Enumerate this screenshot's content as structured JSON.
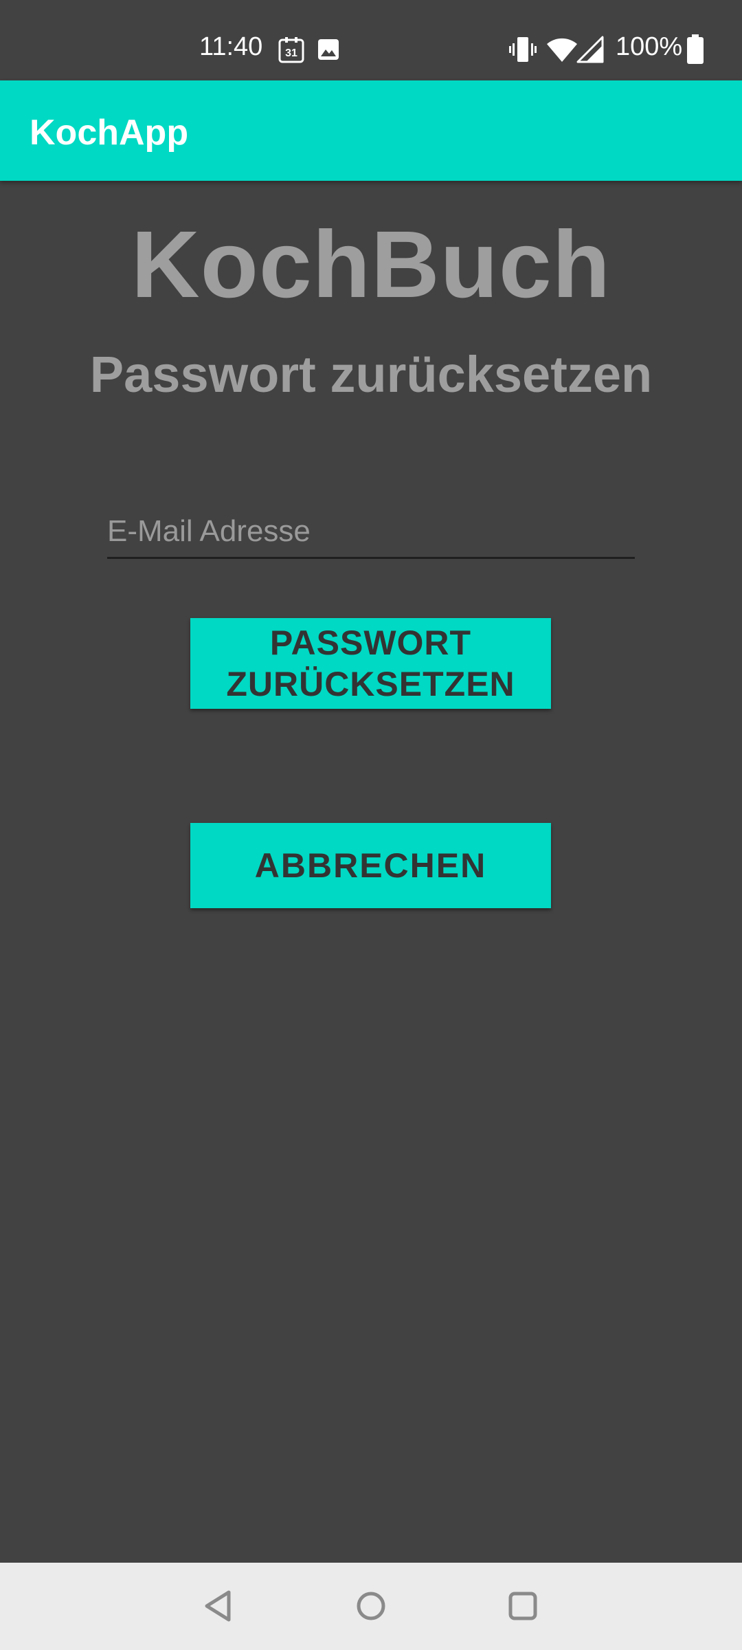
{
  "status_bar": {
    "time": "11:40",
    "calendar_day": "31",
    "battery_percent": "100%",
    "icons": [
      "calendar-icon",
      "image-icon",
      "vibrate-icon",
      "wifi-icon",
      "cell-signal-icon",
      "battery-icon"
    ]
  },
  "app_bar": {
    "title": "KochApp"
  },
  "main": {
    "title": "KochBuch",
    "subtitle": "Passwort zurücksetzen",
    "email_input": {
      "placeholder": "E-Mail Adresse",
      "value": ""
    },
    "reset_button_label": "PASSWORT ZURÜCKSETZEN",
    "cancel_button_label": "ABBRECHEN"
  },
  "nav_bar": {
    "icons": [
      "back-icon",
      "home-icon",
      "recents-icon"
    ]
  },
  "colors": {
    "accent": "#00d9c3",
    "background": "#424242",
    "title_text": "#9e9e9e",
    "button_text": "#333333",
    "nav_background": "#ebebeb"
  }
}
